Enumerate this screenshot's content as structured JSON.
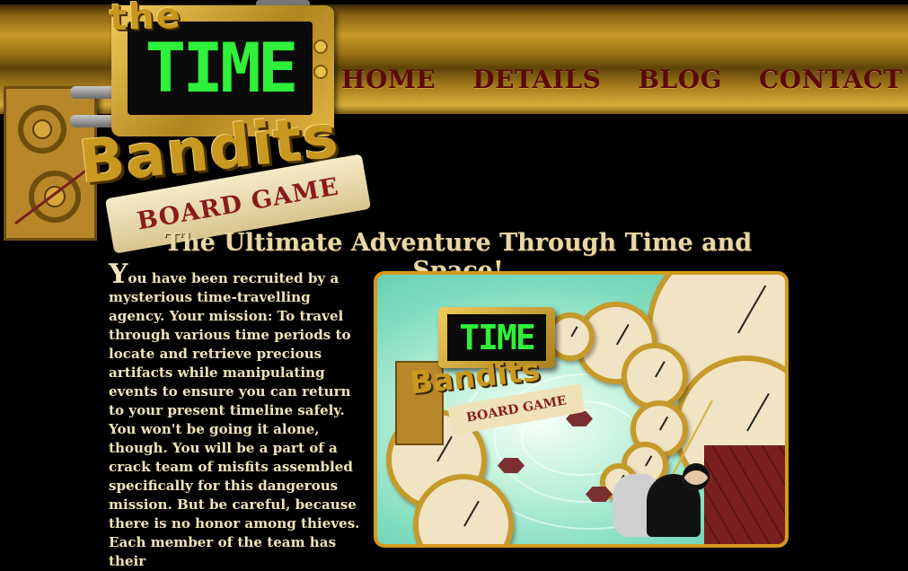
{
  "site": {
    "logo": {
      "word_the": "the",
      "word_time": "TIME",
      "word_bandits": "Bandits",
      "board_game": "BOARD GAME"
    },
    "nav": [
      {
        "label": "HOME"
      },
      {
        "label": "DETAILS"
      },
      {
        "label": "BLOG"
      },
      {
        "label": "CONTACT"
      }
    ]
  },
  "main": {
    "tagline": "The Ultimate Adventure Through Time and Space!",
    "intro_dropcap": "Y",
    "intro_text": "ou have been recruited by a mysterious time-travelling agency. Your mission: To travel through various time periods to locate and retrieve precious artifacts while manipulating events to ensure you can return to your present timeline safely. You won't be going it alone, though. You will be a part of a crack team of misfits assembled specifically for this dangerous mission. But be careful, because there is no honor among thieves. Each member of the team has their"
  },
  "colors": {
    "nav_text": "#5a0a0a",
    "body_text": "#f0e3b8",
    "tagline": "#e8d7a6",
    "screen_green": "#2ff03a",
    "brass": "#c9981f",
    "frame_border": "#d49a1c"
  },
  "icons": [
    "gear-icon",
    "clock-icon"
  ]
}
